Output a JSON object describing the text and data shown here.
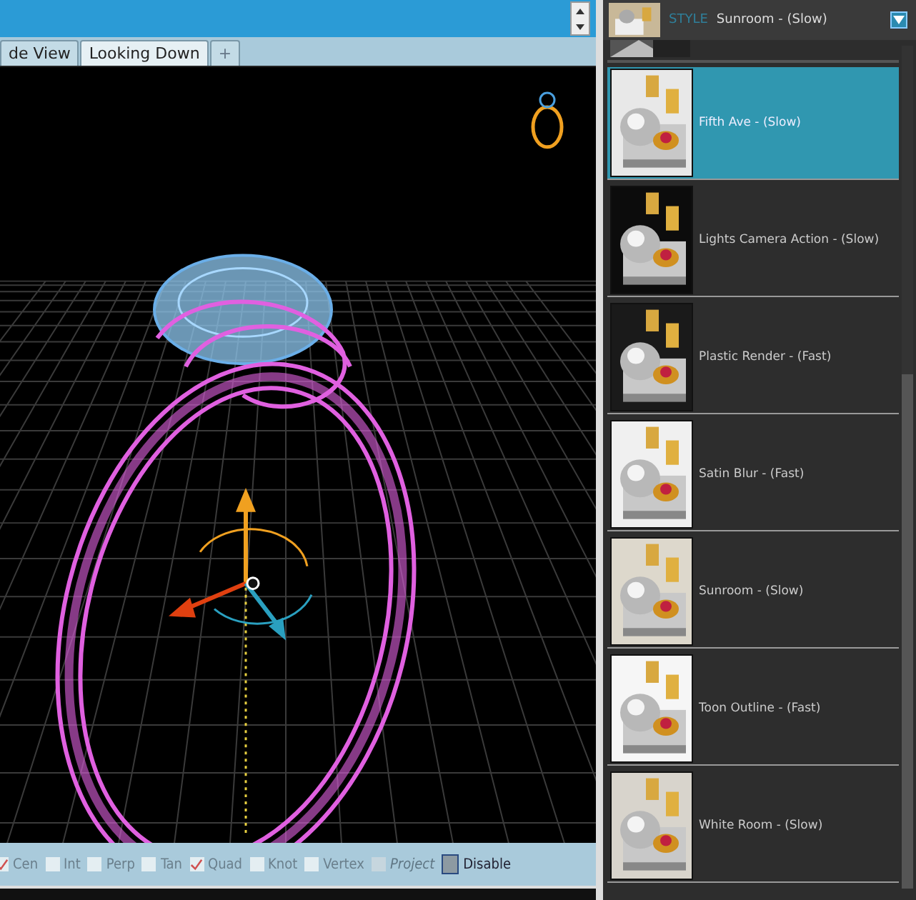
{
  "viewport_tabs": [
    {
      "label": "de View",
      "selected": false
    },
    {
      "label": "Looking Down",
      "selected": true
    }
  ],
  "add_tab": {
    "label": "+"
  },
  "snap_bar": [
    {
      "label": "Cen",
      "kind": "checkbox",
      "checked": true,
      "disabled": false
    },
    {
      "label": "Int",
      "kind": "checkbox",
      "checked": false,
      "disabled": false
    },
    {
      "label": "Perp",
      "kind": "checkbox",
      "checked": false,
      "disabled": false
    },
    {
      "label": "Tan",
      "kind": "checkbox",
      "checked": false,
      "disabled": false
    },
    {
      "label": "Quad",
      "kind": "checkbox",
      "checked": true,
      "disabled": false
    },
    {
      "label": "Knot",
      "kind": "checkbox",
      "checked": false,
      "disabled": false
    },
    {
      "label": "Vertex",
      "kind": "checkbox",
      "checked": false,
      "disabled": false
    },
    {
      "label": "Project",
      "kind": "checkbox",
      "checked": false,
      "disabled": true
    },
    {
      "label": "Disable",
      "kind": "toggle",
      "checked": true
    }
  ],
  "style_header": {
    "label": "STYLE",
    "value": "Sunroom - (Slow)"
  },
  "styles": [
    {
      "name": "Fifth Ave - (Slow)",
      "selected": true
    },
    {
      "name": "Lights Camera Action - (Slow)",
      "selected": false
    },
    {
      "name": "Plastic Render - (Fast)",
      "selected": false
    },
    {
      "name": "Satin Blur - (Fast)",
      "selected": false
    },
    {
      "name": "Sunroom - (Slow)",
      "selected": false
    },
    {
      "name": "Toon Outline - (Fast)",
      "selected": false
    },
    {
      "name": "White Room - (Slow)",
      "selected": false
    }
  ]
}
